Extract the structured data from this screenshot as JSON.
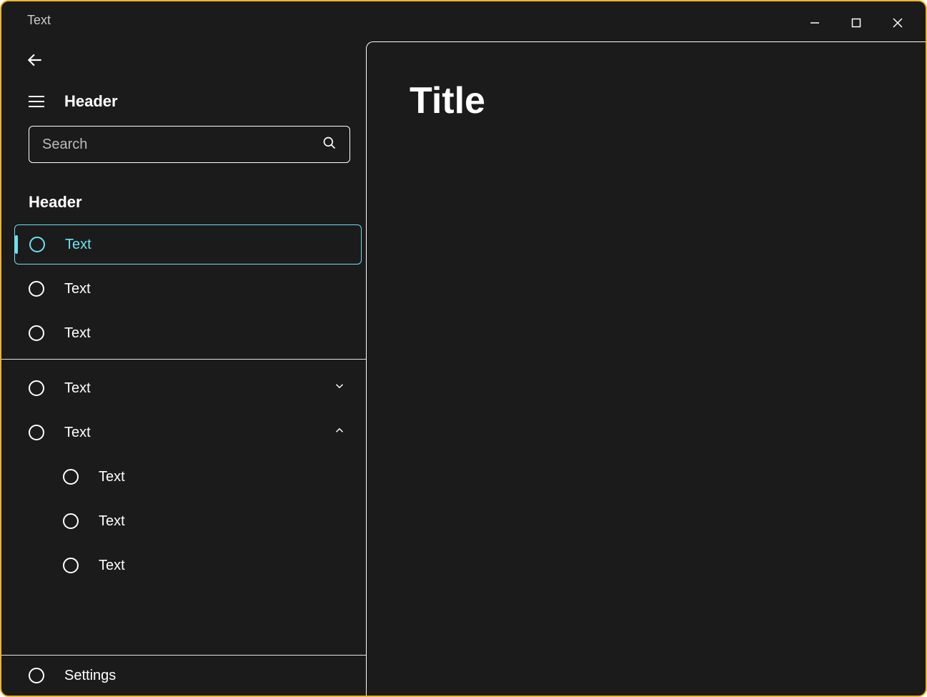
{
  "titlebar": {
    "title": "Text"
  },
  "sidebar": {
    "header_label": "Header",
    "search": {
      "placeholder": "Search"
    },
    "section_header": "Header",
    "group1": [
      {
        "label": "Text",
        "selected": true
      },
      {
        "label": "Text"
      },
      {
        "label": "Text"
      }
    ],
    "group2": [
      {
        "label": "Text",
        "expandable": true,
        "expanded": false
      },
      {
        "label": "Text",
        "expandable": true,
        "expanded": true,
        "children": [
          {
            "label": "Text"
          },
          {
            "label": "Text"
          },
          {
            "label": "Text"
          }
        ]
      }
    ],
    "footer": {
      "label": "Settings"
    }
  },
  "content": {
    "title": "Title"
  }
}
